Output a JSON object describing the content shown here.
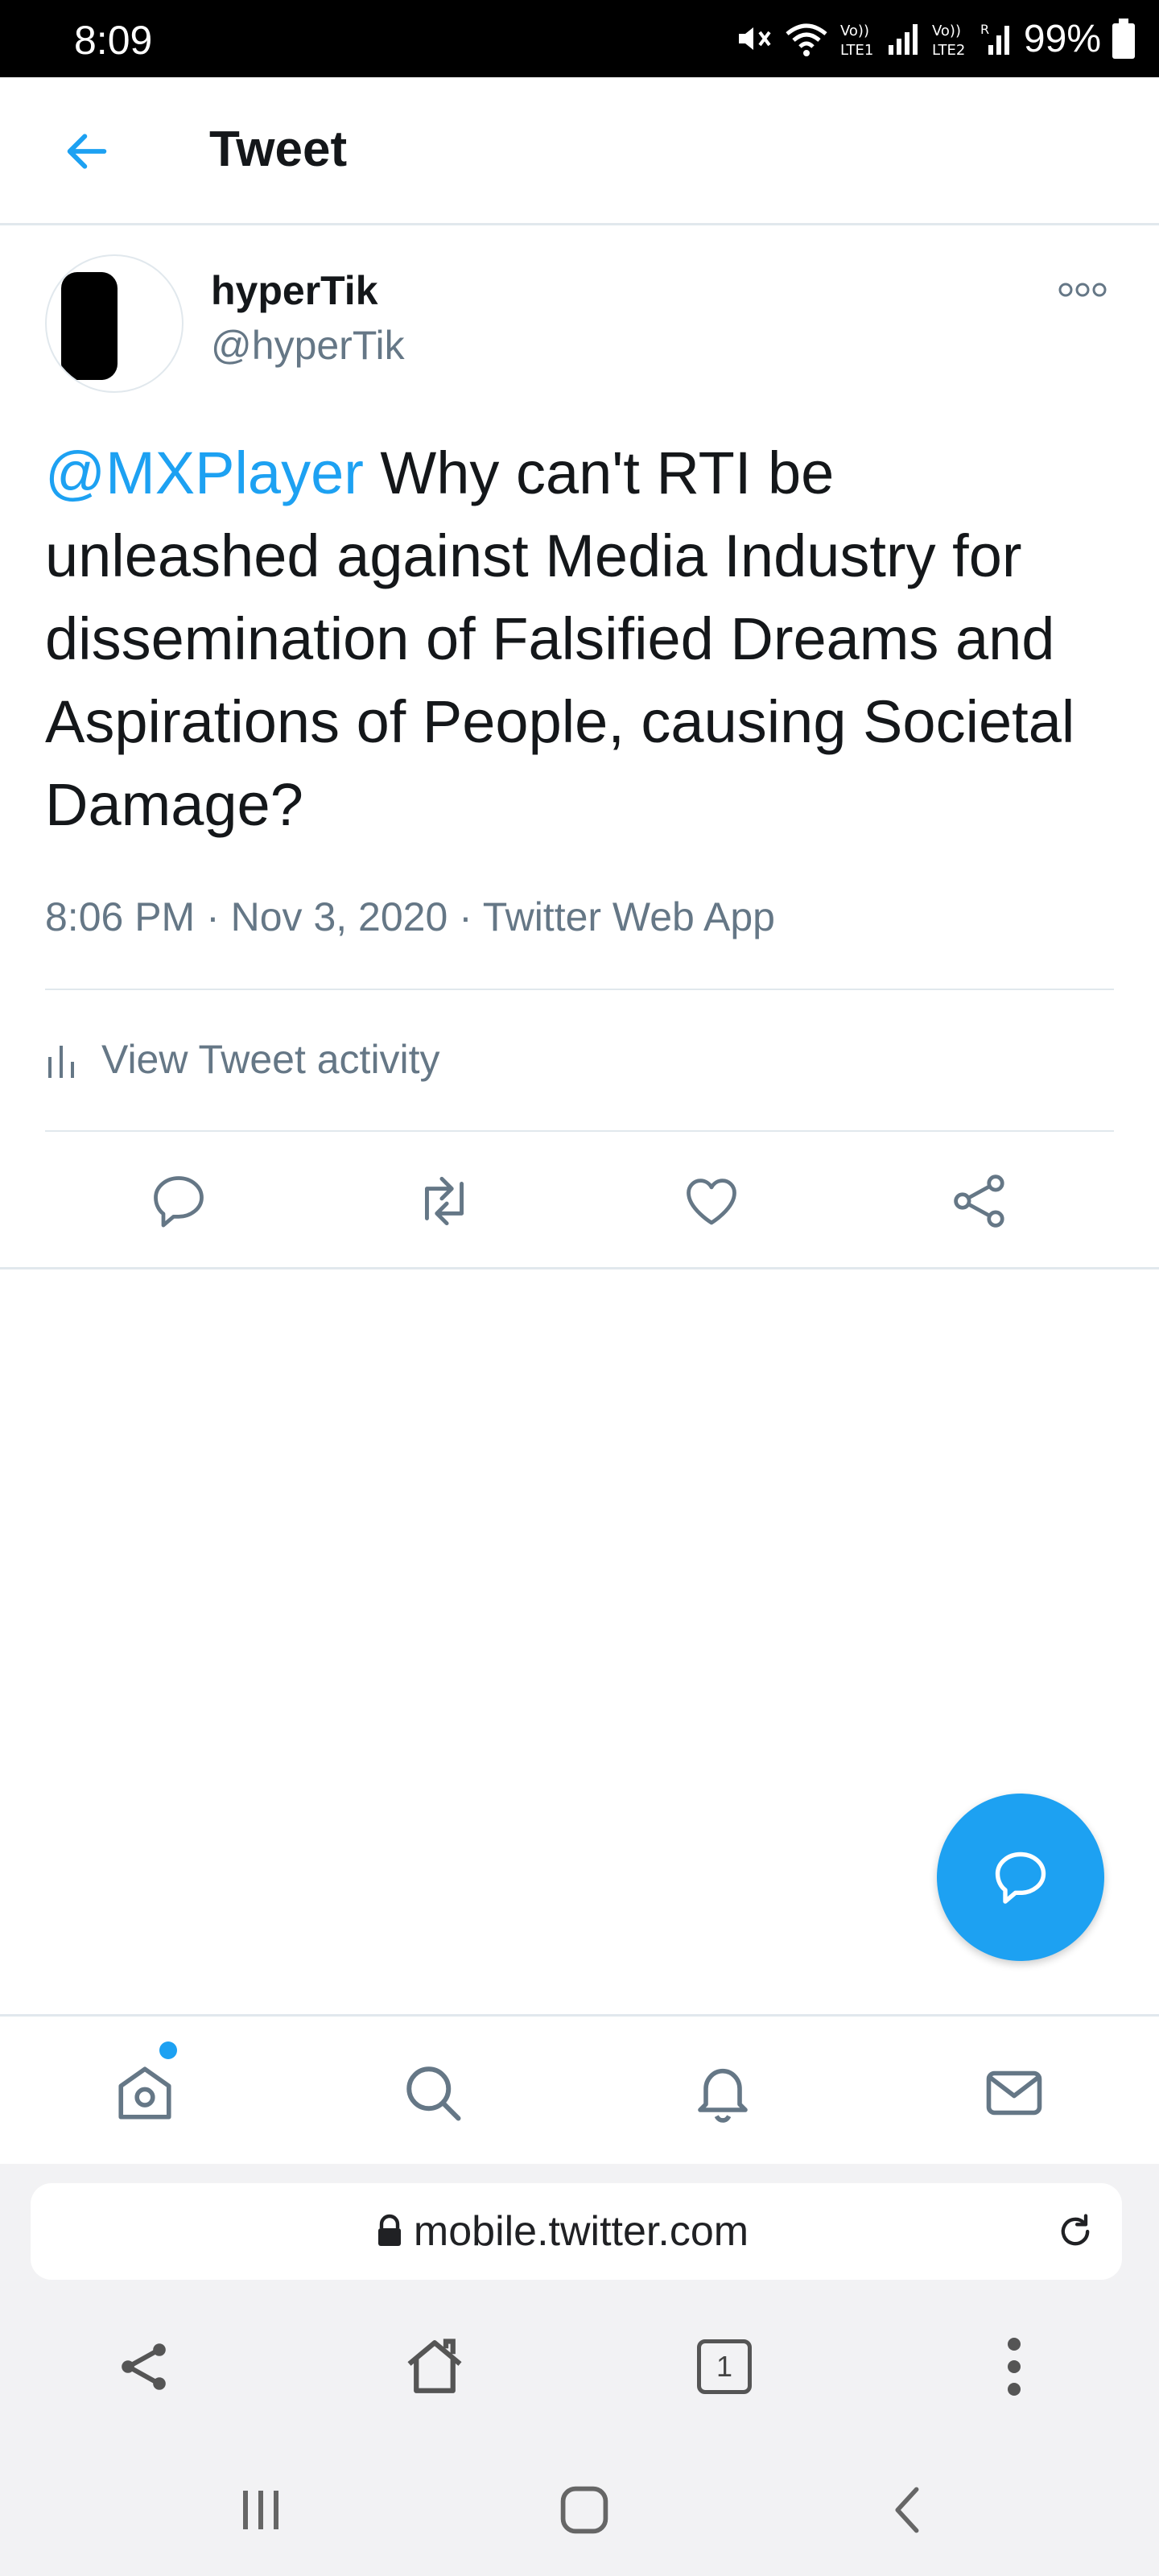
{
  "status_bar": {
    "time": "8:09",
    "battery": "99%"
  },
  "header": {
    "title": "Tweet"
  },
  "tweet": {
    "display_name": "hyperTik",
    "handle": "@hyperTik",
    "mention": "@MXPlayer",
    "text": " Why can't RTI be unleashed against Media Industry for dissemination of Falsified Dreams and Aspirations of People, causing Societal Damage?",
    "meta": "8:06 PM · Nov 3, 2020 · Twitter Web App",
    "activity_label": "View Tweet activity"
  },
  "actions": [
    "reply-icon",
    "retweet-icon",
    "like-icon",
    "share-icon"
  ],
  "bottom_nav": [
    "home-icon",
    "search-icon",
    "notifications-icon",
    "messages-icon"
  ],
  "browser": {
    "url": "mobile.twitter.com",
    "tab_count": "1"
  },
  "colors": {
    "accent": "#1da1f2",
    "secondary_text": "#657786",
    "divider": "#e1e8ed"
  }
}
